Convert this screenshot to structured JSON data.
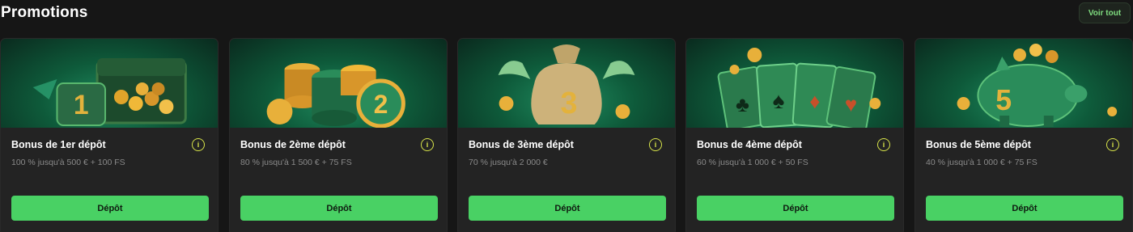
{
  "header": {
    "title": "Promotions",
    "see_all_label": "Voir tout"
  },
  "colors": {
    "accent": "#49d164",
    "info": "#d8e44a",
    "card_bg": "#232323",
    "page_bg": "#161616"
  },
  "cards": [
    {
      "title": "Bonus de 1er dépôt",
      "subtitle": "100 % jusqu'à 500 € + 100 FS",
      "button_label": "Dépôt",
      "image_icon": "treasure-chest-icon"
    },
    {
      "title": "Bonus de 2ème dépôt",
      "subtitle": "80 % jusqu'à 1 500 € + 75 FS",
      "button_label": "Dépôt",
      "image_icon": "casino-chips-icon"
    },
    {
      "title": "Bonus de 3ème dépôt",
      "subtitle": "70 % jusqu'à 2 000 €",
      "button_label": "Dépôt",
      "image_icon": "money-bag-icon"
    },
    {
      "title": "Bonus de 4ème dépôt",
      "subtitle": "60 % jusqu'à 1 000 € + 50 FS",
      "button_label": "Dépôt",
      "image_icon": "playing-cards-icon"
    },
    {
      "title": "Bonus de 5ème dépôt",
      "subtitle": "40 % jusqu'à 1 000 € + 75 FS",
      "button_label": "Dépôt",
      "image_icon": "piggy-bank-icon"
    }
  ]
}
